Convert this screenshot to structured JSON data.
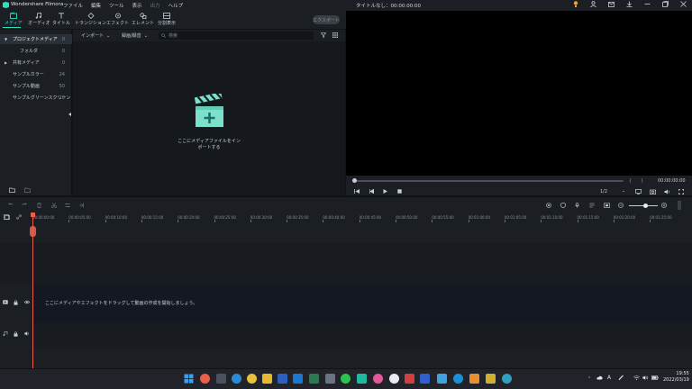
{
  "app": {
    "name": "Wondershare Filmora",
    "project_title": "タイトルなし：00:00:00:00"
  },
  "menu": [
    "ファイル",
    "編集",
    "ツール",
    "表示",
    "出力",
    "ヘルプ"
  ],
  "toolbar": {
    "tabs": [
      {
        "label": "メディア",
        "icon": "media-icon"
      },
      {
        "label": "オーディオ",
        "icon": "music-icon"
      },
      {
        "label": "タイトル",
        "icon": "title-icon"
      },
      {
        "label": "トランジション",
        "icon": "transition-icon"
      },
      {
        "label": "エフェクト",
        "icon": "effect-icon"
      },
      {
        "label": "エレメント",
        "icon": "element-icon"
      },
      {
        "label": "分割表示",
        "icon": "split-icon"
      }
    ],
    "export_label": "エクスポート"
  },
  "sidebar": {
    "items": [
      {
        "label": "プロジェクトメディア",
        "count": "0"
      },
      {
        "label": "フォルダ",
        "count": "0"
      },
      {
        "label": "共有メディア",
        "count": "0"
      },
      {
        "label": "サンプルカラー",
        "count": "24"
      },
      {
        "label": "サンプル動画",
        "count": "50"
      },
      {
        "label": "サンプルグリーンスクリーン",
        "count": "10"
      }
    ]
  },
  "media": {
    "import_label": "インポート",
    "record_label": "録画/録音",
    "search_placeholder": "検索",
    "import_hint": "ここにメディアファイルをインポートする"
  },
  "preview": {
    "timecode": "00:00:00:00",
    "ratio": "1/2"
  },
  "timeline": {
    "ticks": [
      "00:00:00:00",
      "00:00:05:00",
      "00:00:10:00",
      "00:00:15:00",
      "00:00:20:00",
      "00:00:25:00",
      "00:00:30:00",
      "00:00:35:00",
      "00:00:40:00",
      "00:00:45:00",
      "00:00:50:00",
      "00:00:55:00",
      "00:01:00:00",
      "00:01:05:00",
      "00:01:10:00",
      "00:01:15:00",
      "00:01:20:00",
      "00:01:25:00"
    ],
    "drop_hint": "ここにメディアやエフェクトをドラッグして動画の作成を開始しましょう。"
  },
  "taskbar": {
    "time": "19:55",
    "date": "2022/03/19",
    "ime": "A"
  },
  "colors": {
    "accent": "#2ee0c0",
    "playhead": "#e8604c"
  }
}
